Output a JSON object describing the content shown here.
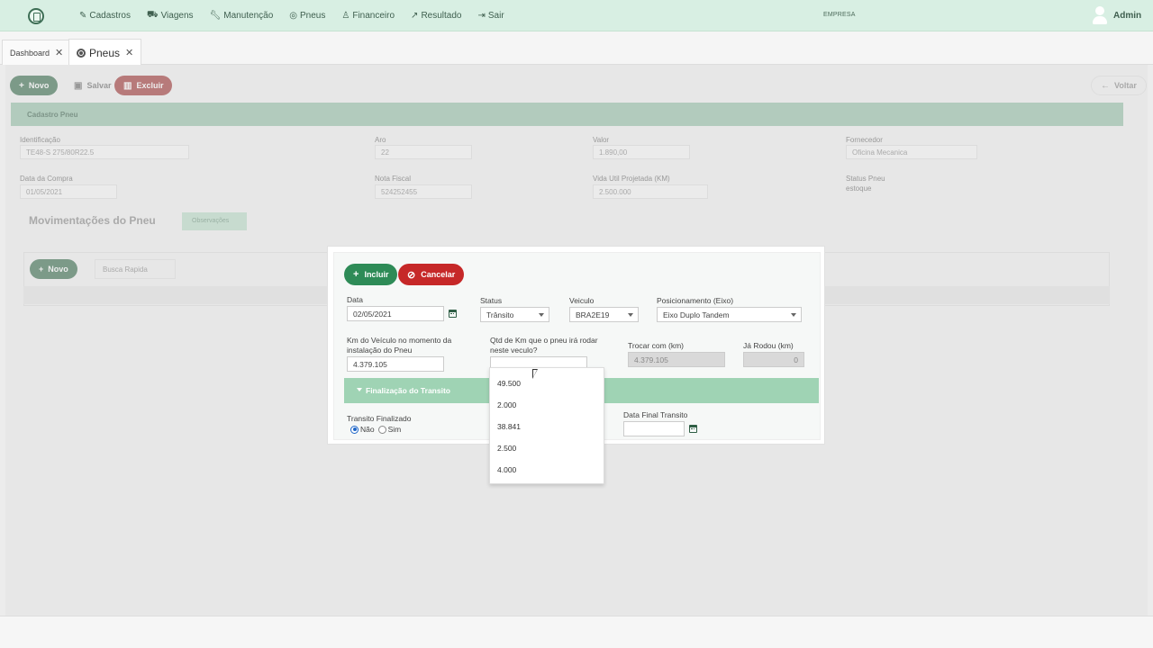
{
  "nav": {
    "items": [
      {
        "label": "Cadastros",
        "icon": "edit-icon"
      },
      {
        "label": "Viagens",
        "icon": "truck-icon"
      },
      {
        "label": "Manutenção",
        "icon": "wrench-icon"
      },
      {
        "label": "Pneus",
        "icon": "tire-icon"
      },
      {
        "label": "Financeiro",
        "icon": "money-icon"
      },
      {
        "label": "Resultado",
        "icon": "chart-icon"
      },
      {
        "label": "Sair",
        "icon": "exit-icon"
      }
    ],
    "empresa": "EMPRESA",
    "user": "Admin"
  },
  "tabs": {
    "dashboard": "Dashboard",
    "pneus": "Pneus"
  },
  "background": {
    "buttons": {
      "novo": "Novo",
      "salvar": "Salvar",
      "excluir": "Excluir",
      "voltar": "Voltar"
    },
    "section": "Cadastro Pneu",
    "fields": {
      "identificacao_label": "Identificação",
      "identificacao_value": "TE48-S 275/80R22.5",
      "aro_label": "Aro",
      "aro_value": "22",
      "valor_label": "Valor",
      "valor_value": "1.890,00",
      "fornecedor_label": "Fornecedor",
      "fornecedor_value": "Oficina Mecanica",
      "data_compra_label": "Data da Compra",
      "data_compra_value": "01/05/2021",
      "nota_fiscal_label": "Nota Fiscal",
      "nota_fiscal_value": "524252455",
      "vida_util_label": "Vida Util Projetada (KM)",
      "vida_util_value": "2.500.000",
      "status_label": "Status Pneu",
      "status_value": "estoque"
    },
    "subtab_title": "Movimentações do Pneu",
    "subtab_obs": "Observações",
    "sub_novo": "Novo",
    "sub_search_placeholder": "Busca Rapida"
  },
  "modal": {
    "incluir": "Incluir",
    "cancelar": "Cancelar",
    "data_label": "Data",
    "data_value": "02/05/2021",
    "status_label": "Status",
    "status_value": "Trânsito",
    "veiculo_label": "Veiculo",
    "veiculo_value": "BRA2E19",
    "posicionamento_label": "Posicionamento (Eixo)",
    "posicionamento_value": "Eixo Duplo Tandem",
    "km_veiculo_label_1": "Km do Veículo no momento da",
    "km_veiculo_label_2": "instalação do Pneu",
    "km_veiculo_value": "4.379.105",
    "qtd_km_label_1": "Qtd de Km que o pneu irá rodar",
    "qtd_km_label_2": "neste veculo?",
    "qtd_km_value": "",
    "trocar_label": "Trocar com (km)",
    "trocar_value": "4.379.105",
    "ja_rodou_label": "Já Rodou (km)",
    "ja_rodou_value": "0",
    "section": "Finalização do Transito",
    "transito_label": "Transito Finalizado",
    "nao": "Não",
    "sim": "Sim",
    "data_final_label": "Data Final Transito",
    "data_final_value": ""
  },
  "dropdown": {
    "options": [
      "49.500",
      "2.000",
      "38.841",
      "2.500",
      "4.000"
    ]
  },
  "colors": {
    "nav_bg": "#d8efe3",
    "primary_green": "#2e8b57",
    "danger_red": "#c62828",
    "section_green": "#9fd3b4",
    "radio_blue": "#1e66c8"
  }
}
